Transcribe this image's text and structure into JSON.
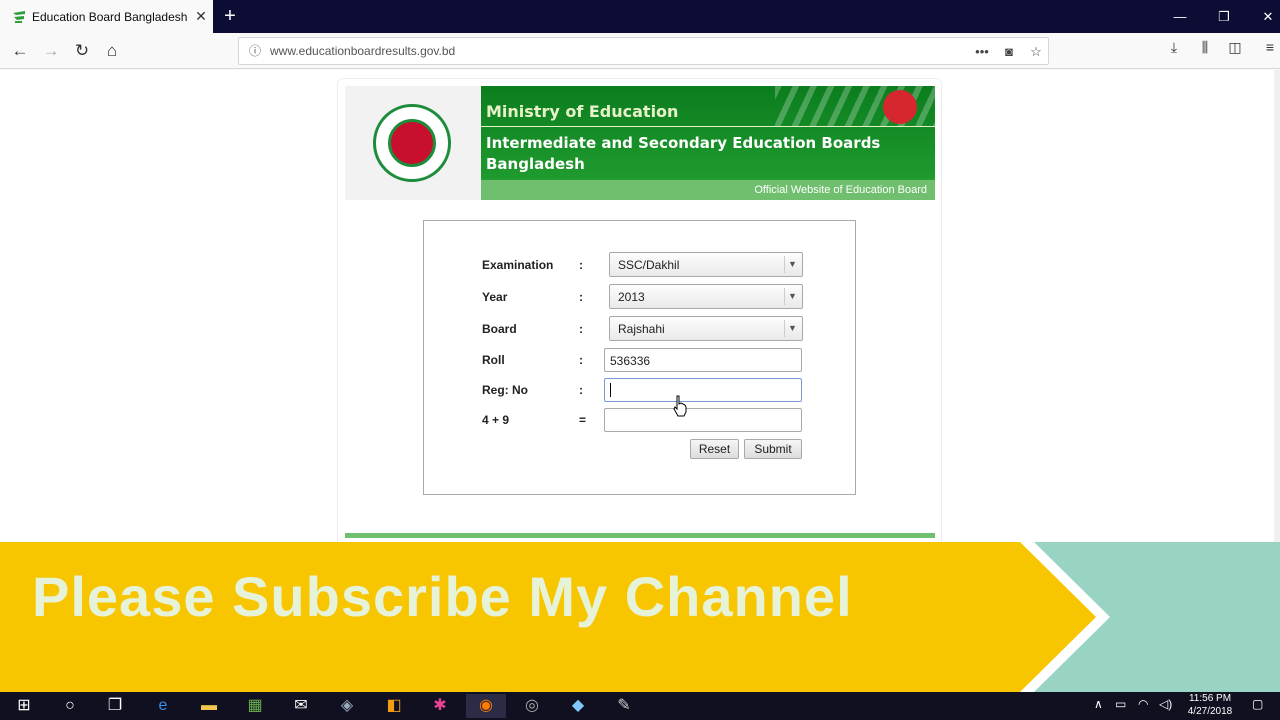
{
  "browser": {
    "tab_title": "Education Board Bangladesh",
    "tab_close": "✕",
    "new_tab": "+",
    "url": "www.educationboardresults.gov.bd"
  },
  "header": {
    "ministry": "Ministry of Education",
    "boards": "Intermediate and Secondary Education Boards Bangladesh",
    "official": "Official Website of Education Board"
  },
  "form": {
    "examination_label": "Examination",
    "examination_value": "SSC/Dakhil",
    "year_label": "Year",
    "year_value": "2013",
    "board_label": "Board",
    "board_value": "Rajshahi",
    "roll_label": "Roll",
    "roll_value": "536336",
    "reg_label": "Reg: No",
    "reg_value": "",
    "captcha_label": "4 + 9",
    "captcha_value": "",
    "colon": ":",
    "equals": "=",
    "reset_label": "Reset",
    "submit_label": "Submit"
  },
  "overlay": {
    "text": "Please Subscribe My Channel"
  },
  "taskbar": {
    "time": "11:56 PM",
    "date": "4/27/2018"
  },
  "colors": {
    "banner_green": "#0b7d1e",
    "overlay_yellow": "#f7c600",
    "overlay_teal": "#99d3c4"
  }
}
